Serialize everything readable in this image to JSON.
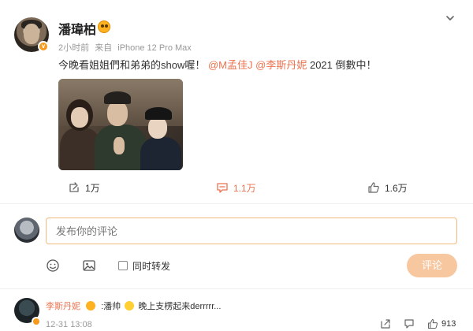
{
  "post": {
    "username": "潘瑋柏",
    "time": "2小时前",
    "source_prefix": "来自",
    "source_device": "iPhone 12 Pro Max",
    "text_before": "今晚看姐姐們和弟弟的show喔！",
    "mention1": "@M孟佳J",
    "mention2": "@李斯丹妮",
    "text_after": "2021 倒數中！",
    "repost_count": "1万",
    "comment_count": "1.1万",
    "like_count": "1.6万"
  },
  "composer": {
    "placeholder": "发布你的评论",
    "forward_label": "同时转发",
    "submit_label": "评论"
  },
  "comment": {
    "author": "李斯丹妮",
    "text_prefix": ":潘帅",
    "text_suffix": "晚上支楞起来derrrrr...",
    "time": "12-31 13:08",
    "like_count": "913"
  },
  "colors": {
    "accent": "#eb7350",
    "submit_bg": "#f7c7a0",
    "input_border": "#f3ba7f"
  },
  "icons": [
    "chevron-down-icon",
    "repost-icon",
    "comment-icon",
    "like-icon",
    "emoji-icon",
    "image-icon",
    "share-icon",
    "reply-icon"
  ]
}
